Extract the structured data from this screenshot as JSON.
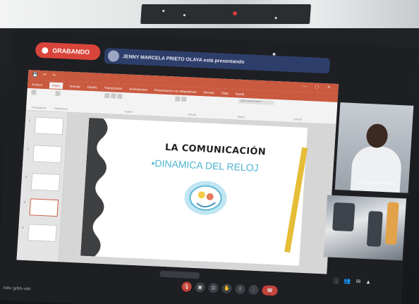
{
  "recording": {
    "label": "GRABANDO"
  },
  "presenter_banner": {
    "text": "JENNY MARCELA PRIETO OLAYA está presentando"
  },
  "powerpoint": {
    "tabs": [
      "Archivo",
      "Inicio",
      "Insertar",
      "Diseño",
      "Transiciones",
      "Animaciones",
      "Presentación con diapositivas",
      "Revisar",
      "Vista",
      "Ayuda",
      "¿Qué desea hacer?"
    ],
    "active_tab": "Inicio",
    "ribbon_groups": [
      "Portapapeles",
      "Diapositivas",
      "Fuente",
      "Párrafo",
      "Dibujo",
      "Edición"
    ],
    "thumbnails": [
      {
        "num": "1",
        "text": ""
      },
      {
        "num": "2",
        "text": ""
      },
      {
        "num": "3",
        "text": ""
      },
      {
        "num": "4",
        "text": ""
      },
      {
        "num": "5",
        "text": ""
      }
    ],
    "slide": {
      "title": "LA COMUNICACIÓN",
      "bullet": "•DINAMICA DEL RELOJ"
    }
  },
  "participants": [
    {
      "name": "JENNY MARCELA PRIETO OLAYA"
    },
    {
      "name": ""
    }
  ],
  "meeting_code": "ndv-jyhh-vbt",
  "colors": {
    "recording_red": "#d9443a",
    "ppt_accent": "#c9593f",
    "banner_blue": "#2e3e6a",
    "bullet_cyan": "#4fb5cf"
  },
  "icons": [
    "mic-icon",
    "camera-icon",
    "captions-icon",
    "raise-hand-icon",
    "present-icon",
    "more-icon",
    "end-call-icon"
  ]
}
